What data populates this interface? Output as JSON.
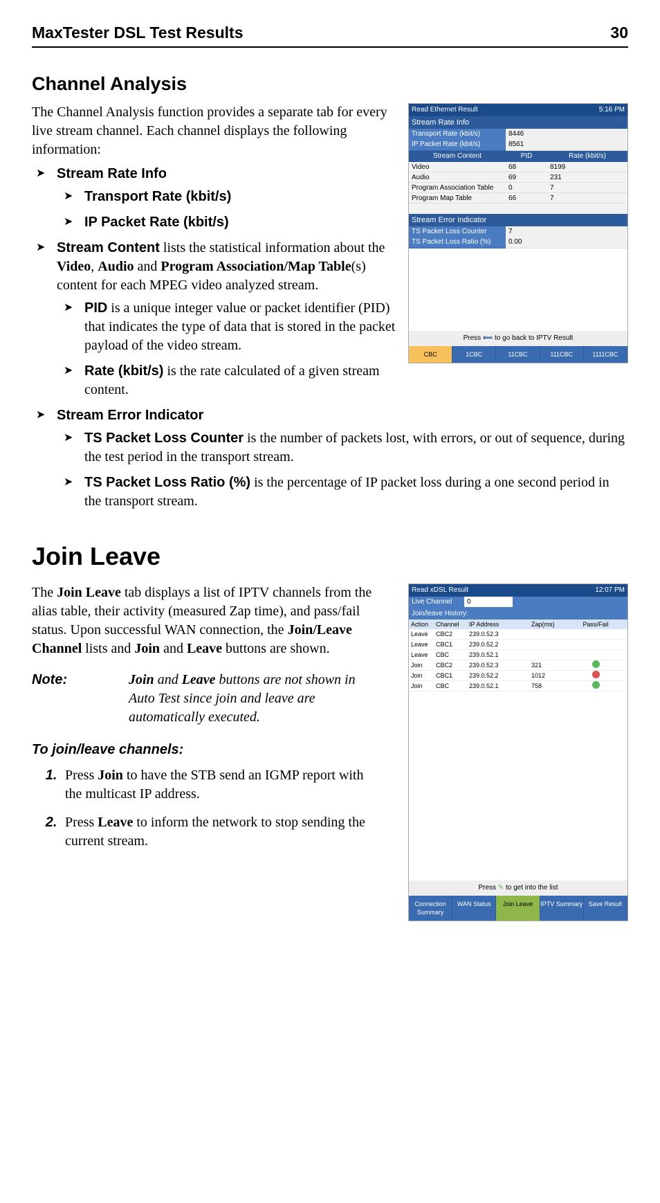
{
  "header": {
    "title": "MaxTester DSL Test Results",
    "page": "30"
  },
  "channelAnalysis": {
    "heading": "Channel Analysis",
    "intro": "The Channel Analysis function provides a separate tab for every live stream channel. Each channel displays the following information:",
    "b1": "Stream Rate Info",
    "b1a": "Transport Rate (kbit/s)",
    "b1b": "IP Packet Rate (kbit/s)",
    "b2_lead": "Stream Content",
    "b2_rest": " lists the statistical information about the ",
    "b2_v": "Video",
    "b2_c1": ", ",
    "b2_a": "Audio",
    "b2_c2": " and ",
    "b2_p": "Program Association/Map Table",
    "b2_tail": "(s) content for each MPEG video analyzed stream.",
    "b2a_lead": "PID",
    "b2a_rest": " is a unique integer value or packet identifier (PID) that indicates the type of data that is stored in the packet payload of the video stream.",
    "b2b_lead": "Rate (kbit/s)",
    "b2b_rest": " is the rate calculated of a given stream content.",
    "b3": "Stream Error Indicator",
    "b3a_lead": "TS Packet Loss Counter",
    "b3a_rest": " is the number of packets lost, with errors, or out of sequence, during the test period in the transport stream.",
    "b3b_lead": "TS Packet Loss Ratio (%)",
    "b3b_rest": " is the percentage of IP packet loss during a one second period in the transport stream."
  },
  "dev1": {
    "top_left": "Read Ethernet Result",
    "top_right": "5:16 PM",
    "sec1": "Stream Rate Info",
    "r1l": "Transport Rate (kbit/s)",
    "r1v": "8446",
    "r2l": "IP Packet Rate (kbit/s)",
    "r2v": "8561",
    "sh1": "Stream Content",
    "sh2": "PID",
    "sh3": "Rate (kbit/s)",
    "rows": [
      {
        "c1": "Video",
        "c2": "68",
        "c3": "8199"
      },
      {
        "c1": "Audio",
        "c2": "69",
        "c3": "231"
      },
      {
        "c1": "Program Association Table",
        "c2": "0",
        "c3": "7"
      },
      {
        "c1": "Program Map Table",
        "c2": "66",
        "c3": "7"
      }
    ],
    "sec2": "Stream Error Indicator",
    "e1l": "TS Packet Loss Counter",
    "e1v": "7",
    "e2l": "TS Packet Loss Ratio (%)",
    "e2v": "0.00",
    "foot_pre": "Press ",
    "foot_post": " to go back to IPTV Result",
    "tabs": [
      "CBC",
      "1CBC",
      "11CBC",
      "111CBC",
      "1111CBC"
    ]
  },
  "joinLeave": {
    "heading": "Join Leave",
    "p_pre": "The ",
    "p_b1": "Join Leave",
    "p_mid1": " tab displays a list of IPTV channels from the alias table, their activity (measured Zap time), and pass/fail status. Upon successful WAN connection, the ",
    "p_b2": "Join/Leave Channel",
    "p_mid2": " lists and ",
    "p_b3": "Join",
    "p_mid3": " and ",
    "p_b4": "Leave",
    "p_tail": " buttons are shown.",
    "note_label": "Note:",
    "note_b1": "Join",
    "note_c1": " and ",
    "note_b2": "Leave",
    "note_rest": " buttons are not shown in Auto Test since join and leave are automatically executed.",
    "subhead": "To join/leave channels:",
    "s1_pre": "Press ",
    "s1_b": "Join",
    "s1_post": " to have the STB send an IGMP report with the multicast IP address.",
    "s2_pre": "Press ",
    "s2_b": "Leave",
    "s2_post": " to inform the network to stop sending the current stream."
  },
  "dev2": {
    "top_left": "Read xDSL Result",
    "top_right": "12:07 PM",
    "live_lbl": "Live Channel",
    "live_val": "0",
    "hist": "Join/leave History:",
    "th": [
      "Action",
      "Channel",
      "IP Address",
      "Zap(ms)",
      "Pass/Fail"
    ],
    "rows": [
      {
        "a": "Leave",
        "ch": "CBC2",
        "ip": "239.0.52.3",
        "z": "",
        "pf": ""
      },
      {
        "a": "Leave",
        "ch": "CBC1",
        "ip": "239.0.52.2",
        "z": "",
        "pf": ""
      },
      {
        "a": "Leave",
        "ch": "CBC",
        "ip": "239.0.52.1",
        "z": "",
        "pf": ""
      },
      {
        "a": "Join",
        "ch": "CBC2",
        "ip": "239.0.52.3",
        "z": "321",
        "pf": "pass"
      },
      {
        "a": "Join",
        "ch": "CBC1",
        "ip": "239.0.52.2",
        "z": "1012",
        "pf": "fail"
      },
      {
        "a": "Join",
        "ch": "CBC",
        "ip": "239.0.52.1",
        "z": "758",
        "pf": "pass"
      }
    ],
    "foot_pre": "Press ",
    "foot_post": " to get into the list",
    "tabs": [
      "Connection Summary",
      "WAN Status",
      "Join Leave",
      "IPTV Summary",
      "Save Result"
    ]
  }
}
